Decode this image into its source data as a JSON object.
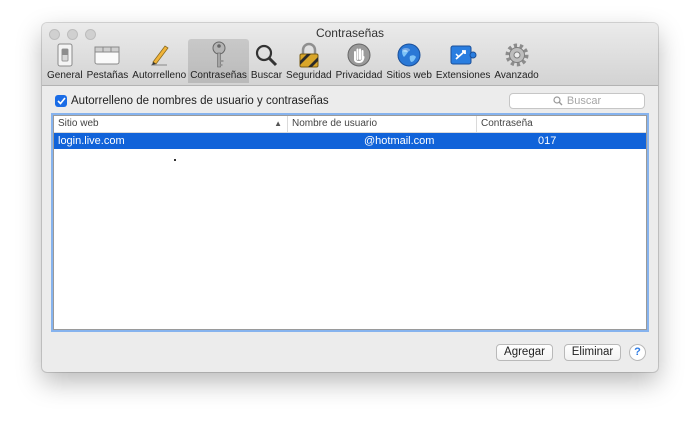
{
  "window": {
    "title": "Contraseñas"
  },
  "toolbar": {
    "tabs": [
      {
        "label": "General",
        "icon": "general-switch-icon"
      },
      {
        "label": "Pestañas",
        "icon": "tabs-icon"
      },
      {
        "label": "Autorrelleno",
        "icon": "pencil-icon"
      },
      {
        "label": "Contraseñas",
        "icon": "key-icon",
        "active": true
      },
      {
        "label": "Buscar",
        "icon": "magnifier-icon"
      },
      {
        "label": "Seguridad",
        "icon": "lock-icon"
      },
      {
        "label": "Privacidad",
        "icon": "hand-icon"
      },
      {
        "label": "Sitios web",
        "icon": "globe-icon"
      },
      {
        "label": "Extensiones",
        "icon": "puzzle-icon"
      },
      {
        "label": "Avanzado",
        "icon": "gear-icon"
      }
    ]
  },
  "autofill": {
    "label": "Autorrelleno de nombres de usuario y contraseñas",
    "checked": true
  },
  "search": {
    "placeholder": "Buscar"
  },
  "table": {
    "columns": [
      "Sitio web",
      "Nombre de usuario",
      "Contraseña"
    ],
    "rows": [
      {
        "site": "login.live.com",
        "user": "@hotmail.com",
        "password": "017"
      }
    ]
  },
  "buttons": {
    "add": "Agregar",
    "remove": "Eliminar",
    "help": "?"
  },
  "colors": {
    "selection": "#1163d9",
    "accent": "#1a6ce6"
  }
}
